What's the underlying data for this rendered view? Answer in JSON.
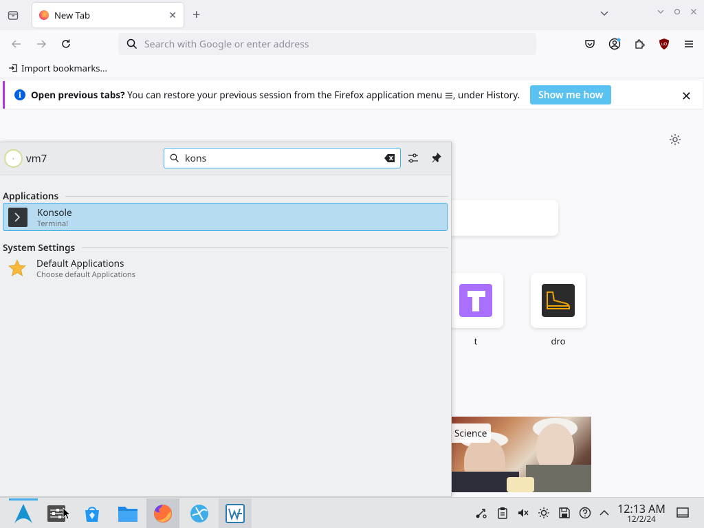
{
  "browser": {
    "tab_title": "New Tab",
    "url_placeholder": "Search with Google or enter address",
    "bookmarks": {
      "import_label": "Import bookmarks..."
    },
    "notification": {
      "bold": "Open previous tabs?",
      "text_before_menu": " You can restore your previous session from the Firefox application menu ",
      "text_after_menu": ", under History.",
      "button": "Show me how"
    },
    "toolbar_icons": [
      "pocket-icon",
      "account-icon",
      "extensions-icon",
      "ublock-icon",
      "menu-icon"
    ]
  },
  "newtab": {
    "shortcuts": [
      {
        "label": "t",
        "icon": "t-tile-icon",
        "color": "#a970ff"
      },
      {
        "label": "dro",
        "icon": "boot-tile-icon",
        "color": "#2b2b2b"
      }
    ],
    "story_tag": "Science"
  },
  "launcher": {
    "username": "vm7",
    "search_value": "kons",
    "sections": [
      {
        "title": "Applications",
        "results": [
          {
            "name": "Konsole",
            "description": "Terminal",
            "icon": "terminal-icon",
            "selected": true
          }
        ]
      },
      {
        "title": "System Settings",
        "results": [
          {
            "name": "Default Applications",
            "description": "Choose default Applications",
            "icon": "star-icon",
            "selected": false
          }
        ]
      }
    ],
    "accent": "#3daee9"
  },
  "taskbar": {
    "apps": [
      "application-launcher-icon",
      "system-settings-icon",
      "discover-icon",
      "file-manager-icon",
      "firefox-icon",
      "browser-icon",
      "libreoffice-icon"
    ],
    "clock": {
      "time": "12:13 AM",
      "date": "12/2/24"
    }
  }
}
